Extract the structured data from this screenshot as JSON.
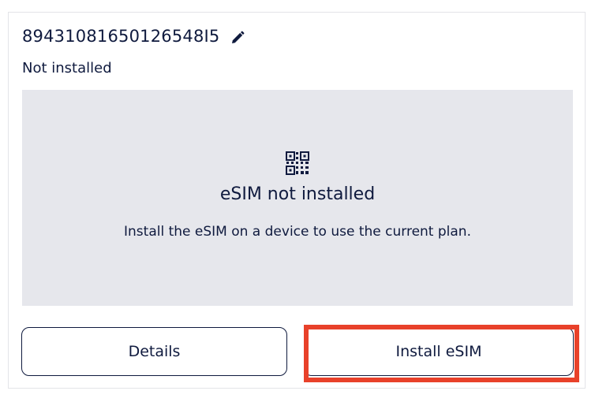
{
  "esim": {
    "iccid": "89431081650126548I5",
    "status": "Not installed"
  },
  "panel": {
    "icon": "qr-code-icon",
    "title": "eSIM not installed",
    "description": "Install the eSIM on a device to use the current plan."
  },
  "actions": {
    "details_label": "Details",
    "install_label": "Install eSIM"
  },
  "icons": {
    "edit": "pencil-edit-icon"
  },
  "colors": {
    "text": "#0f1a3e",
    "panel_background": "#e6e7ec",
    "highlight": "#e8412a",
    "border": "#0f1a3e"
  }
}
